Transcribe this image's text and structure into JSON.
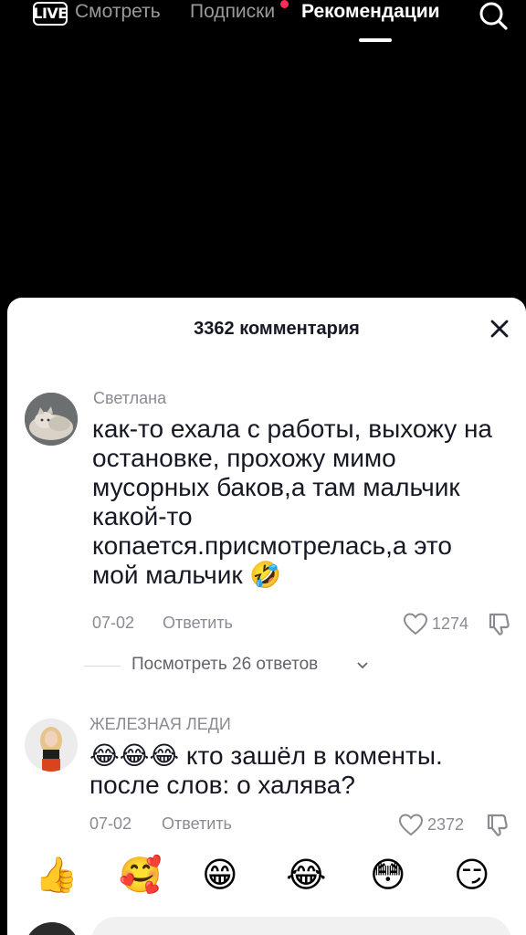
{
  "topbar": {
    "live_label": "LIVE",
    "tabs": [
      {
        "label": "Смотреть",
        "active": false
      },
      {
        "label": "Подписки",
        "active": false
      },
      {
        "label": "Рекомендации",
        "active": true
      }
    ],
    "search_icon": "search-icon"
  },
  "sheet": {
    "title": "3362 комментария",
    "close_icon": "close-icon"
  },
  "comments": [
    {
      "username": "Светлана",
      "text": "как-то ехала с работы, выхожу на остановке, прохожу мимо мусорных баков,а там мальчик какой-то копается.присмотрелась,а это мой мальчик 🤣",
      "date": "07-02",
      "reply_label": "Ответить",
      "likes": "1274"
    },
    {
      "username": "ЖЕЛЕЗНАЯ ЛЕДИ",
      "text": "😂😂😂 кто зашёл в коменты. после слов: о халява?",
      "date": "07-02",
      "reply_label": "Ответить",
      "likes": "2372"
    }
  ],
  "view_replies": "Посмотреть 26 ответов",
  "emoji_bar": [
    "👍",
    "🥰",
    "😁",
    "😂",
    "😳",
    "😏"
  ],
  "colors": {
    "accent": "#fe2c55",
    "text": "#161823",
    "muted": "#8a8b91"
  }
}
